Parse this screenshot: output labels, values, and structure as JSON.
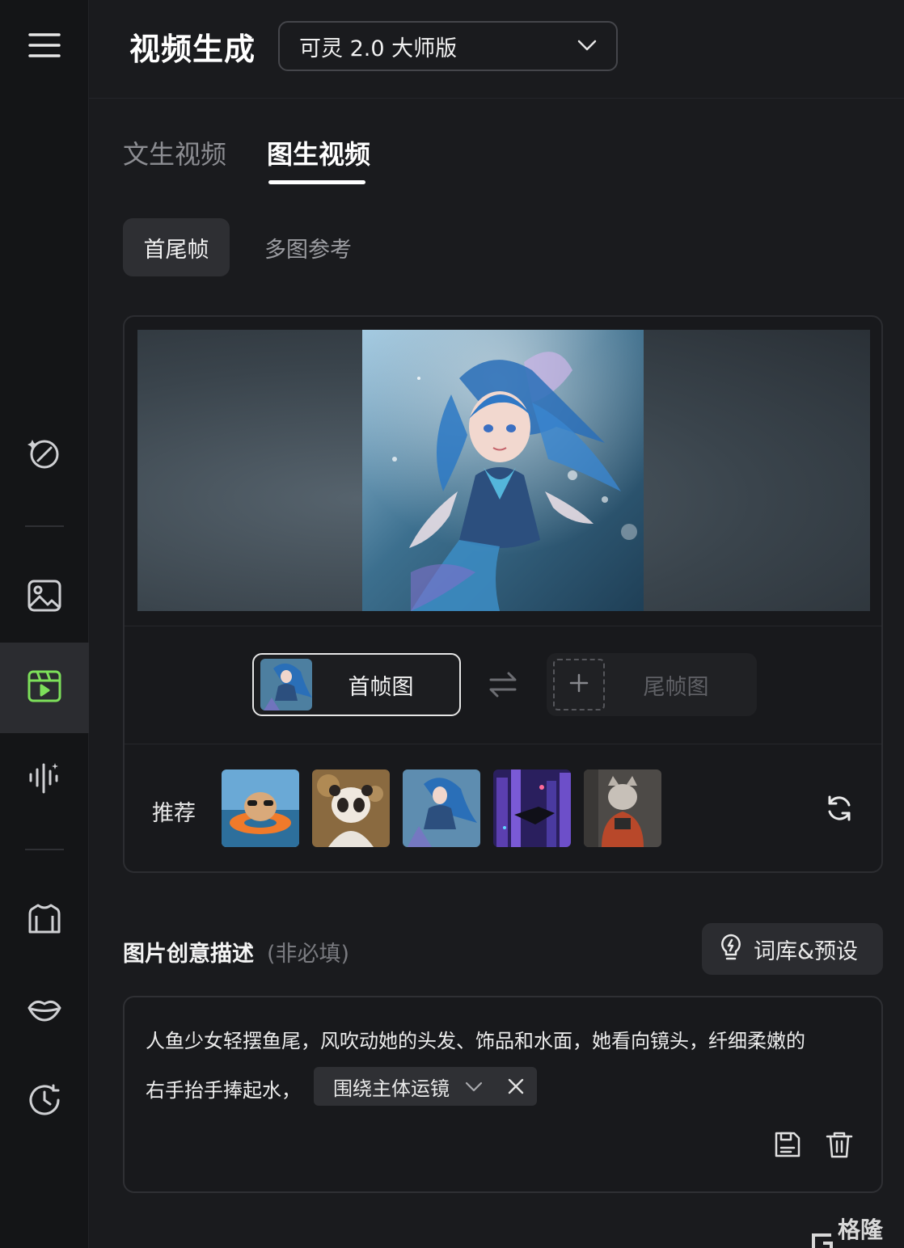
{
  "header": {
    "title": "视频生成",
    "model_select": "可灵 2.0 大师版"
  },
  "tabs": [
    {
      "label": "文生视频",
      "active": false
    },
    {
      "label": "图生视频",
      "active": true
    }
  ],
  "subtabs": [
    {
      "label": "首尾帧",
      "active": true
    },
    {
      "label": "多图参考",
      "active": false
    }
  ],
  "frames": {
    "first_label": "首帧图",
    "last_label": "尾帧图"
  },
  "recommend": {
    "label": "推荐",
    "items": [
      "hamster-swim-ring",
      "panda-cub",
      "mermaid",
      "cyber-city-ship",
      "cat-jacket"
    ]
  },
  "description": {
    "title": "图片创意描述",
    "optional": "(非必填)",
    "library_button": "词库&预设",
    "text_line1": "人鱼少女轻摆鱼尾，风吹动她的头发、饰品和水面，她看向镜头，纤细柔嫩的",
    "text_line2": "右手抬手捧起水，",
    "chip": "围绕主体运镜"
  },
  "sidebar": {
    "active_index": 2
  },
  "watermark": "格隆汇",
  "colors": {
    "accent_green": "#7de05a",
    "background": "#1a1b1e",
    "sidebar": "#141517"
  }
}
